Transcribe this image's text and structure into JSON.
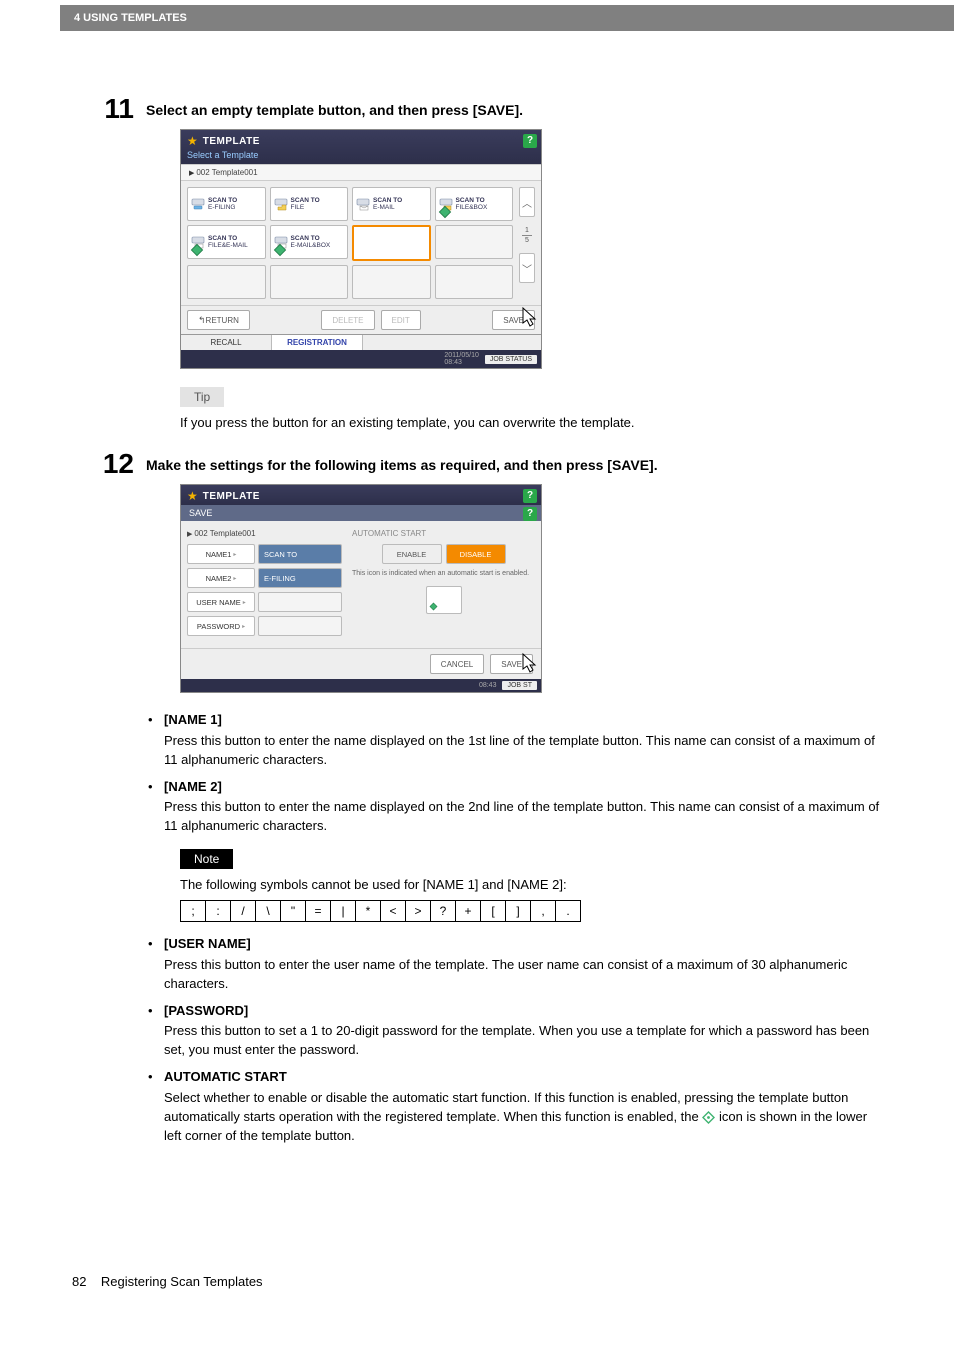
{
  "header": {
    "section": "4 USING TEMPLATES"
  },
  "step11": {
    "num": "11",
    "text": "Select an empty template button, and then press [SAVE].",
    "scr": {
      "title": "TEMPLATE",
      "subtitle": "Select a Template",
      "crumb": "002  Template001",
      "cells": [
        {
          "t1": "SCAN TO",
          "t2": "E-FILING",
          "auto": false
        },
        {
          "t1": "SCAN TO",
          "t2": "FILE",
          "auto": false
        },
        {
          "t1": "SCAN TO",
          "t2": "E-MAIL",
          "auto": false
        },
        {
          "t1": "SCAN TO",
          "t2": "FILE&BOX",
          "auto": true
        },
        {
          "t1": "SCAN TO",
          "t2": "FILE&E-MAIL",
          "auto": true
        },
        {
          "t1": "SCAN TO",
          "t2": "E-MAIL&BOX",
          "auto": true
        }
      ],
      "page_cur": "1",
      "page_tot": "5",
      "btn_return": "RETURN",
      "btn_delete": "DELETE",
      "btn_edit": "EDIT",
      "btn_save": "SAVE",
      "tab_recall": "RECALL",
      "tab_reg": "REGISTRATION",
      "date": "2011/05/10",
      "time": "08:43",
      "job": "JOB STATUS"
    }
  },
  "tip": {
    "label": "Tip",
    "text": "If you press the button for an existing template, you can overwrite the template."
  },
  "step12": {
    "num": "12",
    "text": "Make the settings for the following items as required, and then press [SAVE].",
    "scr": {
      "title": "TEMPLATE",
      "subtitle": "SAVE",
      "crumb": "002  Template001",
      "name1_lab": "NAME1",
      "name1_val": "SCAN TO",
      "name2_lab": "NAME2",
      "name2_val": "E-FILING",
      "user_lab": "USER NAME",
      "pass_lab": "PASSWORD",
      "auto_title": "AUTOMATIC START",
      "enable": "ENABLE",
      "disable": "DISABLE",
      "hint": "This icon is indicated when an automatic start is enabled.",
      "cancel": "CANCEL",
      "save": "SAVE",
      "time": "08:43",
      "job": "JOB ST"
    }
  },
  "items": {
    "name1": {
      "t": "[NAME 1]",
      "d": "Press this button to enter the name displayed on the 1st line of the template button. This name can consist of a maximum of 11 alphanumeric characters."
    },
    "name2": {
      "t": "[NAME 2]",
      "d": "Press this button to enter the name displayed on the 2nd line of the template button. This name can consist of a maximum of 11 alphanumeric characters."
    },
    "user": {
      "t": "[USER NAME]",
      "d": "Press this button to enter the user name of the template. The user name can consist of a maximum of 30 alphanumeric characters."
    },
    "pass": {
      "t": "[PASSWORD]",
      "d": "Press this button to set a 1 to 20-digit password for the template. When you use a template for which a password has been set, you must enter the password."
    },
    "auto": {
      "t": "AUTOMATIC START",
      "d1": "Select whether to enable or disable the automatic start function. If this function is enabled, pressing the template button automatically starts operation with the registered template. When this function is enabled, the ",
      "d2": " icon is shown in the lower left corner of the template button."
    }
  },
  "note": {
    "label": "Note",
    "text": "The following symbols cannot be used for [NAME 1] and [NAME 2]:"
  },
  "symbols": [
    ";",
    ":",
    "/",
    "\\",
    "\"",
    "=",
    "|",
    "*",
    "<",
    ">",
    "?",
    "+",
    "[",
    "]",
    ",",
    "."
  ],
  "footer": {
    "page": "82",
    "title": "Registering Scan Templates"
  }
}
